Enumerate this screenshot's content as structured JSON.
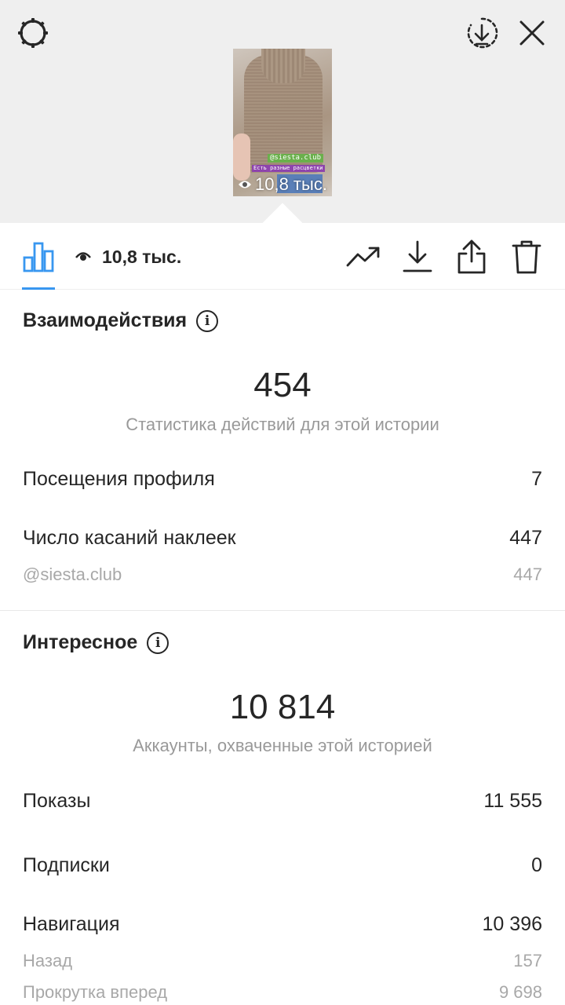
{
  "preview": {
    "sticker_handle": "@siesta.club",
    "sticker_text": "Есть разные расцветки",
    "views": "10,8 тыс."
  },
  "toolbar": {
    "views": "10,8 тыс."
  },
  "interactions": {
    "title": "Взаимодействия",
    "total": "454",
    "caption": "Статистика действий для этой истории",
    "rows": [
      {
        "label": "Посещения профиля",
        "value": "7"
      },
      {
        "label": "Число касаний наклеек",
        "value": "447"
      }
    ],
    "sub_rows": [
      {
        "label": "@siesta.club",
        "value": "447"
      }
    ]
  },
  "discovery": {
    "title": "Интересное",
    "total": "10 814",
    "caption": "Аккаунты, охваченные этой историей",
    "rows": [
      {
        "label": "Показы",
        "value": "11 555"
      },
      {
        "label": "Подписки",
        "value": "0"
      },
      {
        "label": "Навигация",
        "value": "10 396"
      }
    ],
    "sub_rows": [
      {
        "label": "Назад",
        "value": "157"
      },
      {
        "label": "Прокрутка вперед",
        "value": "9 698"
      }
    ]
  },
  "colors": {
    "accent": "#3897f0",
    "text": "#262626",
    "muted": "#999999"
  }
}
